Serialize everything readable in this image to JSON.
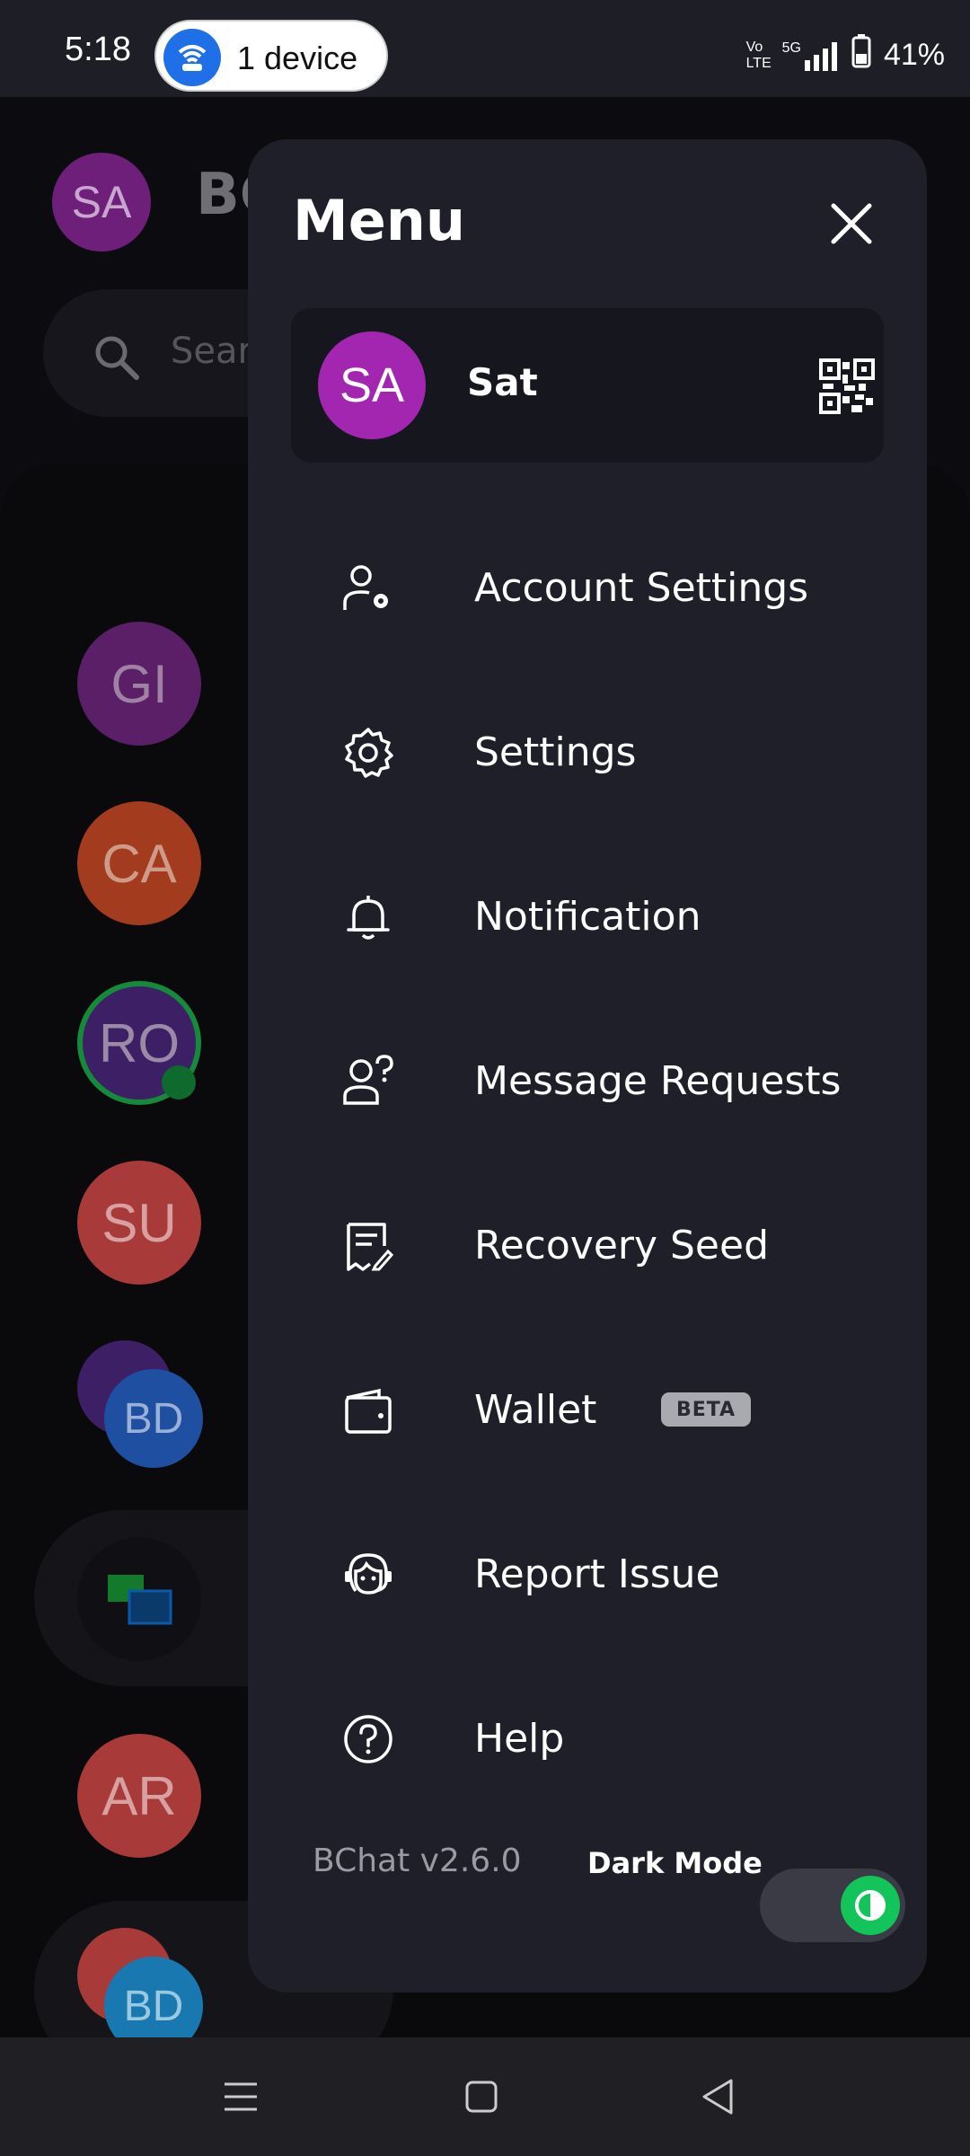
{
  "status_bar": {
    "time": "5:18",
    "hotspot_label": "1 device",
    "network": "5G",
    "volte": "Vo LTE",
    "battery": "41%"
  },
  "background": {
    "header_avatar": "SA",
    "app_title": "BC",
    "search_placeholder": "Searc",
    "chats": [
      {
        "initials": "GI",
        "color": "#5a1f66"
      },
      {
        "initials": "CA",
        "color": "#a33c1e"
      },
      {
        "initials": "RO",
        "color": "#3d1f66"
      },
      {
        "initials": "SU",
        "color": "#a83a3a"
      },
      {
        "initials": "BD",
        "color": "#1e4fa0"
      },
      {
        "initials": "",
        "color": "#1a1a20"
      },
      {
        "initials": "AR",
        "color": "#a83a3a"
      },
      {
        "initials": "BD",
        "color": "#1a78b0"
      }
    ]
  },
  "menu": {
    "title": "Menu",
    "close_icon": "close-icon",
    "profile": {
      "initials": "SA",
      "name": "Sat",
      "avatar_color": "#a326b0"
    },
    "items": [
      {
        "label": "Account Settings",
        "icon": "account-settings-icon"
      },
      {
        "label": "Settings",
        "icon": "gear-icon"
      },
      {
        "label": "Notification",
        "icon": "bell-icon"
      },
      {
        "label": "Message Requests",
        "icon": "message-request-icon"
      },
      {
        "label": "Recovery Seed",
        "icon": "recovery-seed-icon"
      },
      {
        "label": "Wallet",
        "icon": "wallet-icon",
        "badge": "BETA"
      },
      {
        "label": "Report Issue",
        "icon": "support-agent-icon"
      },
      {
        "label": "Help",
        "icon": "help-icon"
      }
    ],
    "version": "BChat v2.6.0",
    "dark_mode_label": "Dark Mode",
    "dark_mode_enabled": true,
    "accent_color": "#12c45a"
  },
  "navbar": {
    "icons": [
      "menu-lines-icon",
      "home-square-icon",
      "back-triangle-icon"
    ]
  }
}
